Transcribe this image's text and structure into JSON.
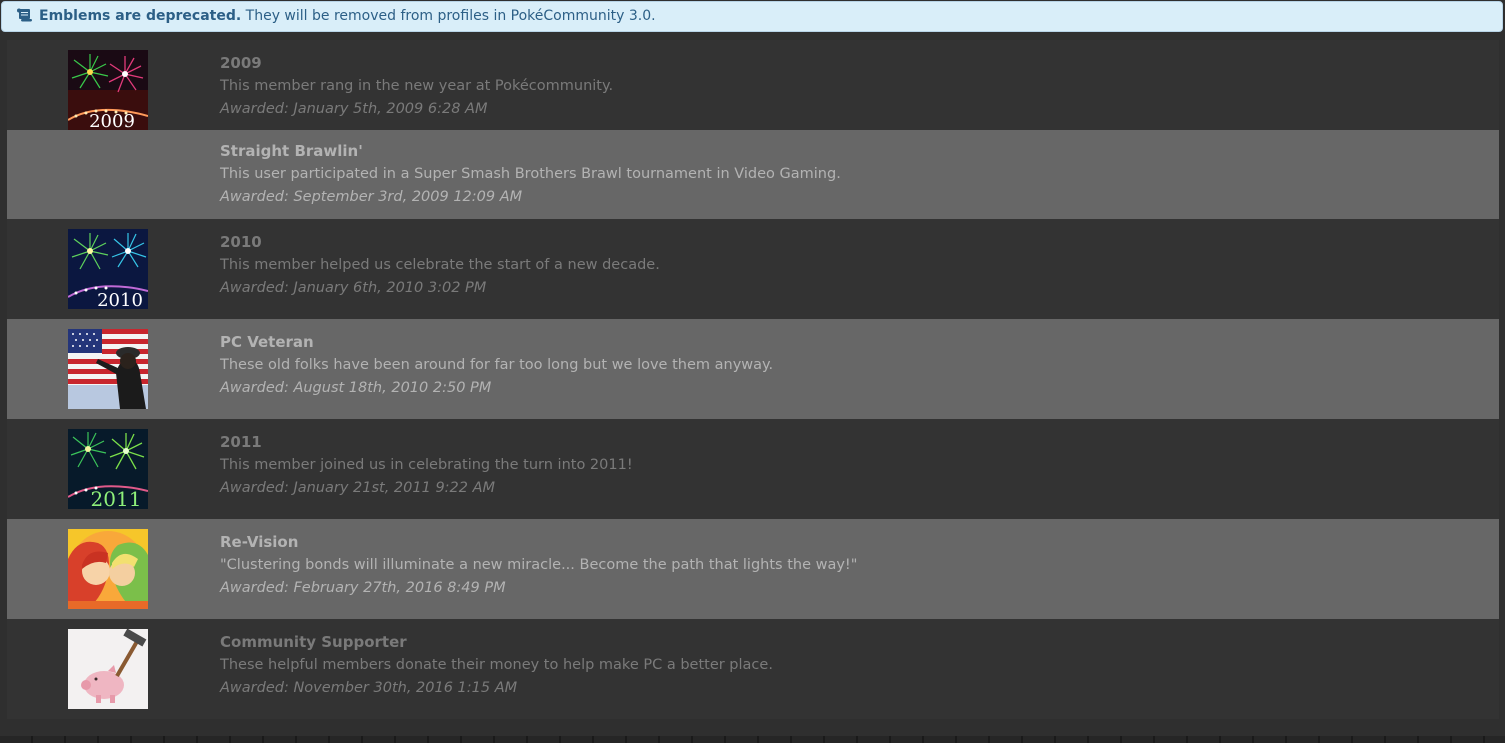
{
  "notice": {
    "bold_text": "Emblems are deprecated.",
    "text": " They will be removed from profiles in PokéCommunity 3.0.",
    "icon": "scroll-icon"
  },
  "emblems": [
    {
      "title": "2009",
      "description": "This member rang in the new year at Pokécommunity.",
      "awarded": "Awarded: January 5th, 2009 6:28 AM",
      "image": "fireworks-2009-icon",
      "image_year": "2009"
    },
    {
      "title": "Straight Brawlin'",
      "description": "This user participated in a Super Smash Brothers Brawl tournament in Video Gaming.",
      "awarded": "Awarded: September 3rd, 2009 12:09 AM",
      "image": ""
    },
    {
      "title": "2010",
      "description": "This member helped us celebrate the start of a new decade.",
      "awarded": "Awarded: January 6th, 2010 3:02 PM",
      "image": "fireworks-2010-icon",
      "image_year": "2010"
    },
    {
      "title": "PC Veteran",
      "description": "These old folks have been around for far too long but we love them anyway.",
      "awarded": "Awarded: August 18th, 2010 2:50 PM",
      "image": "veteran-salute-icon"
    },
    {
      "title": "2011",
      "description": "This member joined us in celebrating the turn into 2011!",
      "awarded": "Awarded: January 21st, 2011 9:22 AM",
      "image": "fireworks-2011-icon",
      "image_year": "2011"
    },
    {
      "title": "Re-Vision",
      "description": "\"Clustering bonds will illuminate a new miracle... Become the path that lights the way!\"",
      "awarded": "Awarded: February 27th, 2016 8:49 PM",
      "image": "revision-art-icon"
    },
    {
      "title": "Community Supporter",
      "description": "These helpful members donate their money to help make PC a better place.",
      "awarded": "Awarded: November 30th, 2016 1:15 AM",
      "image": "piggy-bank-hammer-icon"
    }
  ],
  "colors": {
    "background": "#2f2f2f",
    "row_dark": "#333333",
    "row_light": "#676767",
    "notice_bg": "#d9eef9",
    "notice_text": "#2c5f86"
  }
}
